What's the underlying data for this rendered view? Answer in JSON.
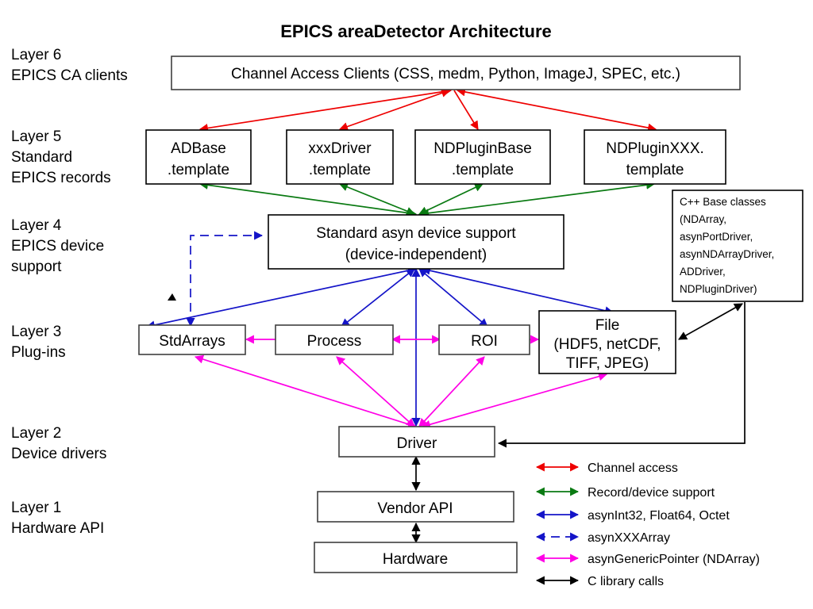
{
  "title": "EPICS areaDetector Architecture",
  "layers": [
    {
      "id": "layer6",
      "lines": [
        "Layer 6",
        "EPICS CA clients"
      ]
    },
    {
      "id": "layer5",
      "lines": [
        "Layer 5",
        "Standard",
        "EPICS records"
      ]
    },
    {
      "id": "layer4",
      "lines": [
        "Layer 4",
        "EPICS device",
        "support"
      ]
    },
    {
      "id": "layer3",
      "lines": [
        "Layer 3",
        "Plug-ins"
      ]
    },
    {
      "id": "layer2",
      "lines": [
        "Layer 2",
        "Device drivers"
      ]
    },
    {
      "id": "layer1",
      "lines": [
        "Layer 1",
        "Hardware API"
      ]
    }
  ],
  "boxes": {
    "ca_clients": {
      "label": "Channel Access Clients (CSS, medm, Python, ImageJ, SPEC, etc.)"
    },
    "adbase": {
      "line1": "ADBase",
      "line2": ".template"
    },
    "xxxdriver": {
      "line1": "xxxDriver",
      "line2": ".template"
    },
    "ndpluginbase": {
      "line1": "NDPluginBase",
      "line2": ".template"
    },
    "ndpluginxxx": {
      "line1": "NDPluginXXX.",
      "line2": "template"
    },
    "asyn": {
      "line1": "Standard asyn device support",
      "line2": "(device-independent)"
    },
    "cppbase": {
      "lines": [
        "C++ Base classes",
        "(NDArray,",
        "asynPortDriver,",
        "asynNDArrayDriver,",
        "ADDriver,",
        "NDPluginDriver)"
      ]
    },
    "stdarrays": {
      "label": "StdArrays"
    },
    "process": {
      "label": "Process"
    },
    "roi": {
      "label": "ROI"
    },
    "file": {
      "line1": "File",
      "line2": "(HDF5, netCDF,",
      "line3": "TIFF, JPEG)"
    },
    "driver": {
      "label": "Driver"
    },
    "vendor_api": {
      "label": "Vendor API"
    },
    "hardware": {
      "label": "Hardware"
    }
  },
  "legend": [
    {
      "label": "Channel access",
      "color": "#ee0000",
      "style": "solid",
      "arrows": "both"
    },
    {
      "label": "Record/device support",
      "color": "#0a7a12",
      "style": "solid",
      "arrows": "both"
    },
    {
      "label": "asynInt32, Float64, Octet",
      "color": "#1414c8",
      "style": "solid",
      "arrows": "both"
    },
    {
      "label": "asynXXXArray",
      "color": "#1414c8",
      "style": "dashed",
      "arrows": "both"
    },
    {
      "label": "asynGenericPointer (NDArray)",
      "color": "#ff00e6",
      "style": "solid",
      "arrows": "both"
    },
    {
      "label": "C library calls",
      "color": "#000000",
      "style": "solid",
      "arrows": "both"
    }
  ],
  "colors": {
    "channel_access": "#ee0000",
    "record_device": "#0a7a12",
    "asyn_scalar": "#1414c8",
    "asyn_array": "#1414c8",
    "generic_pointer": "#ff00e6",
    "c_library": "#000000",
    "box_stroke": "#3f3f3f",
    "background": "#ffffff"
  }
}
